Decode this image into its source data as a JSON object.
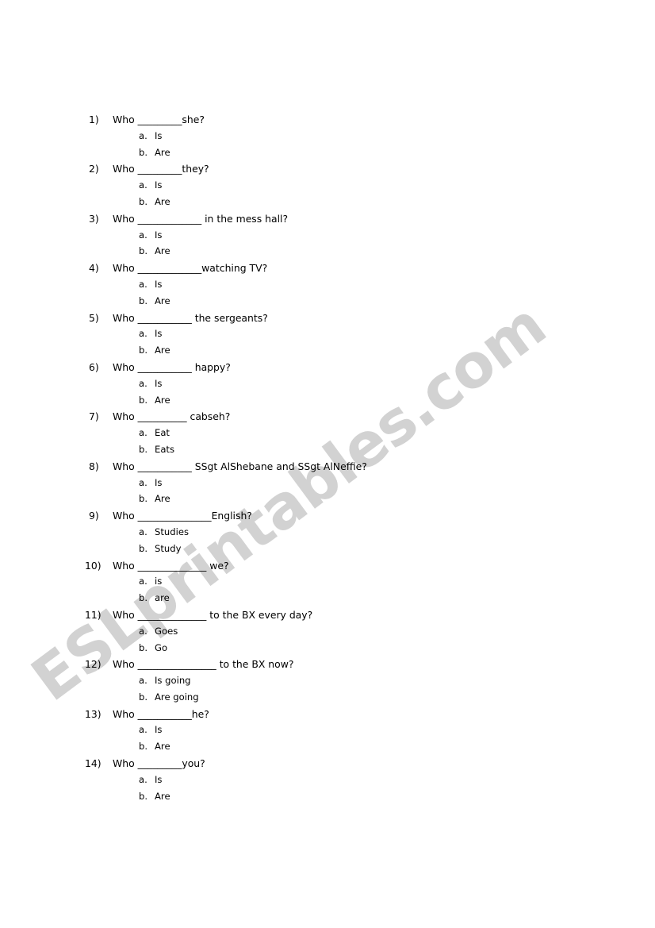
{
  "document": {
    "title": "Who questions worksheet",
    "background_color": "#ffffff",
    "text_color": "#000000"
  },
  "watermark": {
    "text": "ESLprintables.com",
    "color": "#d2d2d2",
    "rotation_degrees": -36.5
  },
  "worksheet": {
    "questions": [
      {
        "number": "1)",
        "prefix": "Who ",
        "blank": "_________",
        "suffix": "she?",
        "options": [
          {
            "label": "a.",
            "text": "Is"
          },
          {
            "label": "b.",
            "text": "Are"
          }
        ]
      },
      {
        "number": "2)",
        "prefix": "Who ",
        "blank": "_________",
        "suffix": "they?",
        "options": [
          {
            "label": "a.",
            "text": "Is"
          },
          {
            "label": "b.",
            "text": "Are"
          }
        ]
      },
      {
        "number": "3)",
        "prefix": "Who ",
        "blank": "_____________",
        "suffix": " in the mess hall?",
        "options": [
          {
            "label": "a.",
            "text": "Is"
          },
          {
            "label": "b.",
            "text": "Are"
          }
        ]
      },
      {
        "number": "4)",
        "prefix": "Who ",
        "blank": "_____________",
        "suffix": "watching TV?",
        "options": [
          {
            "label": "a.",
            "text": "Is"
          },
          {
            "label": "b.",
            "text": "Are"
          }
        ]
      },
      {
        "number": "5)",
        "prefix": "Who ",
        "blank": "___________",
        "suffix": " the sergeants?",
        "options": [
          {
            "label": "a.",
            "text": "Is"
          },
          {
            "label": "b.",
            "text": "Are"
          }
        ]
      },
      {
        "number": "6)",
        "prefix": "Who ",
        "blank": "___________",
        "suffix": " happy?",
        "options": [
          {
            "label": "a.",
            "text": "Is"
          },
          {
            "label": "b.",
            "text": "Are"
          }
        ]
      },
      {
        "number": "7)",
        "prefix": "Who ",
        "blank": "__________",
        "suffix": " cabseh?",
        "options": [
          {
            "label": "a.",
            "text": "Eat"
          },
          {
            "label": "b.",
            "text": "Eats"
          }
        ]
      },
      {
        "number": "8)",
        "prefix": "Who ",
        "blank": "___________",
        "suffix": " SSgt AlShebane and SSgt AlNeffie?",
        "options": [
          {
            "label": "a.",
            "text": "Is"
          },
          {
            "label": "b.",
            "text": "Are"
          }
        ]
      },
      {
        "number": "9)",
        "prefix": "Who ",
        "blank": "_______________",
        "suffix": "English?",
        "options": [
          {
            "label": "a.",
            "text": "Studies"
          },
          {
            "label": "b.",
            "text": "Study"
          }
        ]
      },
      {
        "number": "10)",
        "prefix": "Who ",
        "blank": "______________",
        "suffix": " we?",
        "options": [
          {
            "label": "a.",
            "text": "is"
          },
          {
            "label": "b.",
            "text": "are"
          }
        ]
      },
      {
        "number": "11)",
        "prefix": "Who ",
        "blank": "______________",
        "suffix": " to the BX every day?",
        "options": [
          {
            "label": "a.",
            "text": "Goes"
          },
          {
            "label": "b.",
            "text": "Go"
          }
        ]
      },
      {
        "number": "12)",
        "prefix": "Who ",
        "blank": "________________",
        "suffix": " to the BX now?",
        "options": [
          {
            "label": "a.",
            "text": "Is going"
          },
          {
            "label": "b.",
            "text": "Are going"
          }
        ]
      },
      {
        "number": "13)",
        "prefix": "Who ",
        "blank": "___________",
        "suffix": "he?",
        "options": [
          {
            "label": "a.",
            "text": "Is"
          },
          {
            "label": "b.",
            "text": "Are"
          }
        ]
      },
      {
        "number": "14)",
        "prefix": "Who ",
        "blank": "_________",
        "suffix": "you?",
        "options": [
          {
            "label": "a.",
            "text": "Is"
          },
          {
            "label": "b.",
            "text": "Are"
          }
        ]
      }
    ]
  }
}
